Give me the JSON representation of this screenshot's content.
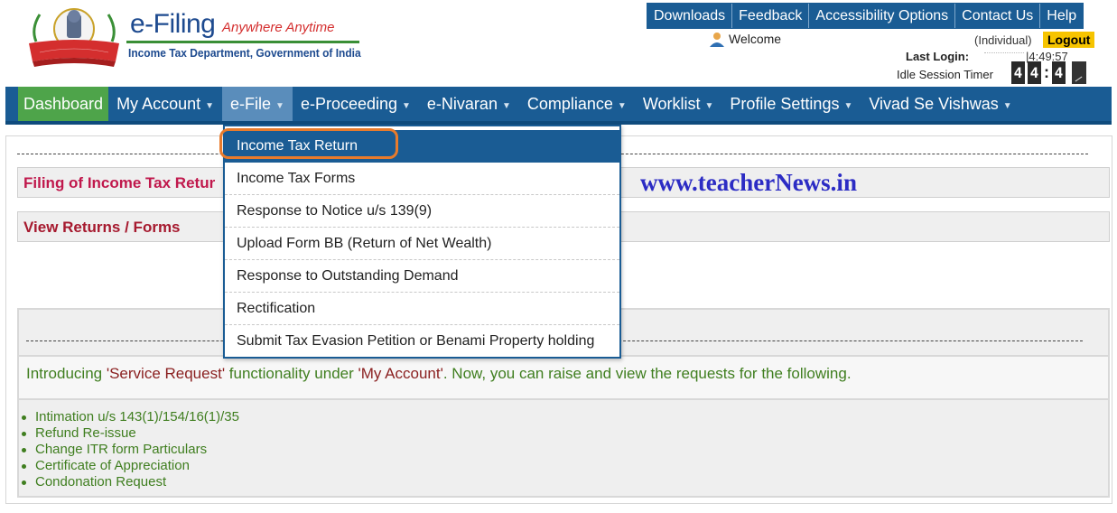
{
  "header": {
    "brand_title": "e-Filing",
    "brand_tagline": "Anywhere Anytime",
    "brand_subtitle": "Income Tax Department, Government of India",
    "emblem_text": "INCOME TAX DEPARTMENT",
    "top_links": [
      "Downloads",
      "Feedback",
      "Accessibility Options",
      "Contact Us",
      "Help"
    ],
    "welcome_text": "Welcome",
    "user_type": "(Individual)",
    "logout_label": "Logout",
    "last_login_label": "Last Login:",
    "last_login_time": "|4:49:57",
    "idle_label": "Idle Session Timer",
    "timer_digits": [
      "4",
      "4",
      "4"
    ]
  },
  "nav": {
    "items": [
      {
        "label": "Dashboard",
        "state": "active"
      },
      {
        "label": "My Account",
        "caret": true
      },
      {
        "label": "e-File",
        "caret": true,
        "state": "open"
      },
      {
        "label": "e-Proceeding",
        "caret": true
      },
      {
        "label": "e-Nivaran",
        "caret": true
      },
      {
        "label": "Compliance",
        "caret": true
      },
      {
        "label": "Worklist",
        "caret": true
      },
      {
        "label": "Profile Settings",
        "caret": true
      },
      {
        "label": "Vivad Se Vishwas",
        "caret": true
      }
    ]
  },
  "dropdown": {
    "items": [
      "Income Tax Return",
      "Income Tax Forms",
      "Response to Notice u/s 139(9)",
      "Upload Form BB (Return of Net Wealth)",
      "Response to Outstanding Demand",
      "Rectification",
      "Submit Tax Evasion Petition or Benami Property holding"
    ],
    "selected_index": 0
  },
  "content": {
    "filing_bar": "Filing of Income Tax Retur",
    "view_bar": "View Returns / Forms",
    "watermark": "www.teacherNews.in",
    "notice": {
      "prefix": "Introducing ",
      "highlight": "'Service Request'",
      "middle": " functionality under ",
      "highlight2": "'My Account'",
      "suffix": ". Now, you can raise and view the requests for the following."
    },
    "services": [
      "Intimation u/s 143(1)/154/16(1)/35",
      "Refund Re-issue",
      "Change ITR form Particulars",
      "Certificate of Appreciation",
      "Condonation Request"
    ]
  },
  "colors": {
    "nav_blue": "#1a5c94",
    "dashboard_green": "#4ea44a",
    "logout_yellow": "#f6c400",
    "highlight_orange": "#e87b2c",
    "notice_green": "#3f7e1f"
  }
}
